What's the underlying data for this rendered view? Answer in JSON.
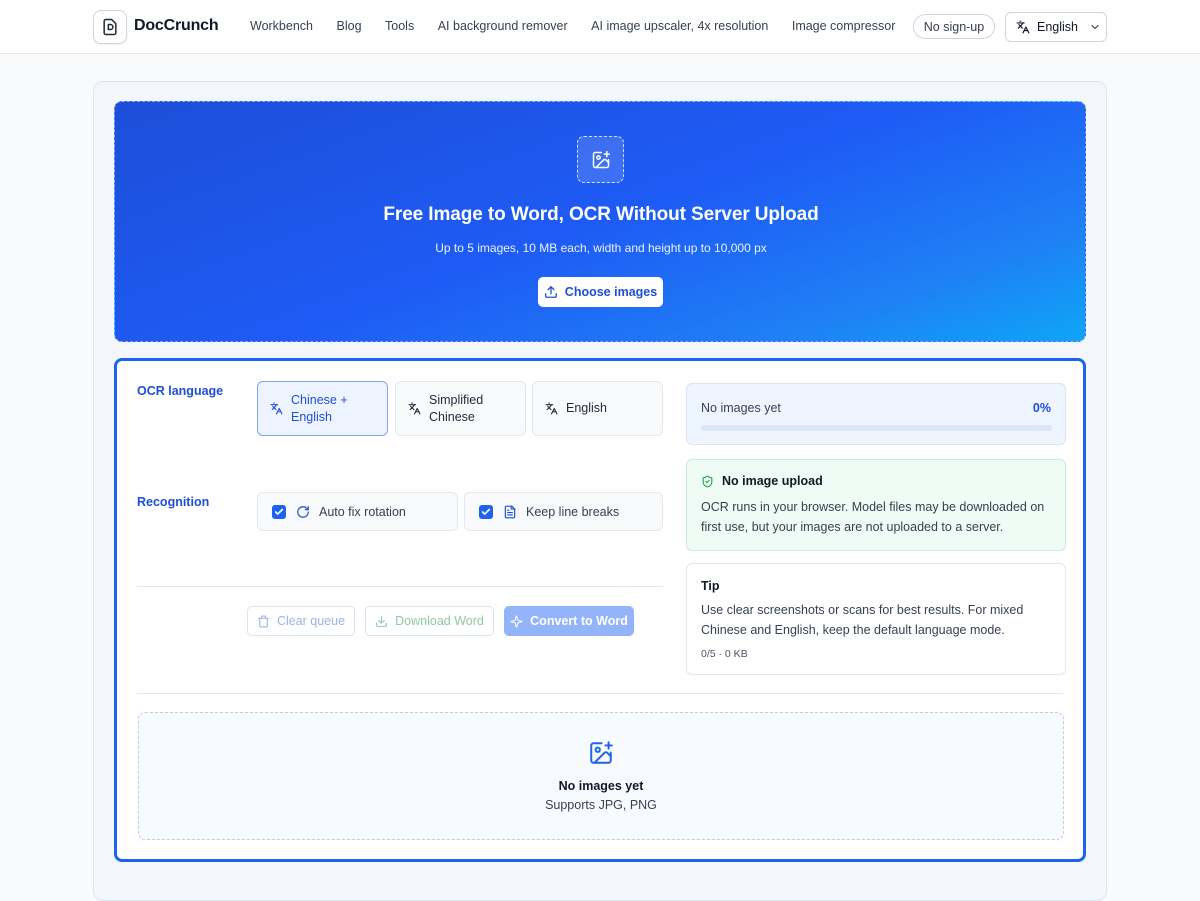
{
  "header": {
    "brand": "DocCrunch",
    "nav": [
      "Workbench",
      "Blog",
      "Tools",
      "AI background remover",
      "AI image upscaler, 4x resolution",
      "Image compressor"
    ],
    "no_signup": "No sign-up",
    "language": "English"
  },
  "hero": {
    "title": "Free Image to Word, OCR Without Server Upload",
    "subtitle": "Up to 5 images, 10 MB each, width and height up to 10,000 px",
    "choose_label": "Choose images"
  },
  "settings": {
    "ocr_language_label": "OCR language",
    "languages": [
      {
        "label": "Chinese + English",
        "selected": true
      },
      {
        "label": "Simplified Chinese",
        "selected": false
      },
      {
        "label": "English",
        "selected": false
      }
    ],
    "recognition_label": "Recognition",
    "options": [
      {
        "label": "Auto fix rotation",
        "checked": true
      },
      {
        "label": "Keep line breaks",
        "checked": true
      }
    ]
  },
  "actions": {
    "clear": "Clear queue",
    "download": "Download Word",
    "convert": "Convert to Word"
  },
  "progress": {
    "status": "No images yet",
    "percent_label": "0%",
    "value": 0
  },
  "privacy": {
    "title": "No image upload",
    "body": "OCR runs in your browser. Model files may be downloaded on first use, but your images are not uploaded to a server."
  },
  "tip": {
    "title": "Tip",
    "body": "Use clear screenshots or scans for best results. For mixed Chinese and English, keep the default language mode.",
    "stats": "0/5 · 0 KB"
  },
  "empty_state": {
    "title": "No images yet",
    "subtitle": "Supports JPG, PNG"
  },
  "colors": {
    "accent": "#1d63ec",
    "hero_start": "#1d4ed8",
    "hero_end": "#0ea5f6",
    "success_bg": "#effbf5",
    "success_icon": "#16a34a"
  }
}
